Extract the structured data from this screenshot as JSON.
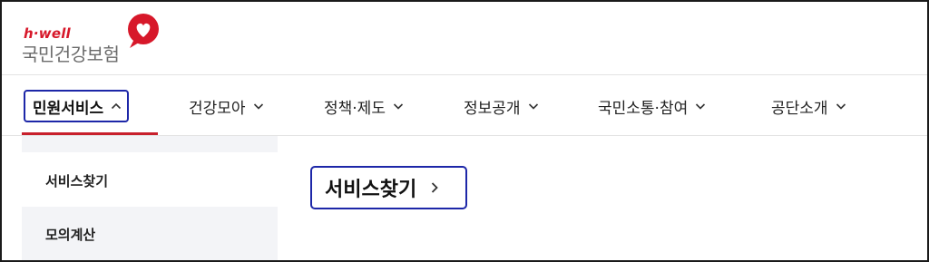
{
  "logo": {
    "small_text": "h·well",
    "main_text": "국민건강보험",
    "brand_color": "#d7182a"
  },
  "nav": {
    "items": [
      {
        "label": "민원서비스",
        "icon": "chevron-up-icon",
        "active": true
      },
      {
        "label": "건강모아",
        "icon": "chevron-down-icon"
      },
      {
        "label": "정책·제도",
        "icon": "chevron-down-icon"
      },
      {
        "label": "정보공개",
        "icon": "chevron-down-icon"
      },
      {
        "label": "국민소통·참여",
        "icon": "chevron-down-icon"
      },
      {
        "label": "공단소개",
        "icon": "chevron-down-icon"
      }
    ],
    "active_underline_color": "#c8202c",
    "highlight_color": "#1d27a8"
  },
  "sidebar": {
    "items": [
      {
        "label": "서비스찾기"
      },
      {
        "label": "모의계산"
      }
    ]
  },
  "content": {
    "title": "서비스찾기",
    "icon": "chevron-right-icon"
  }
}
